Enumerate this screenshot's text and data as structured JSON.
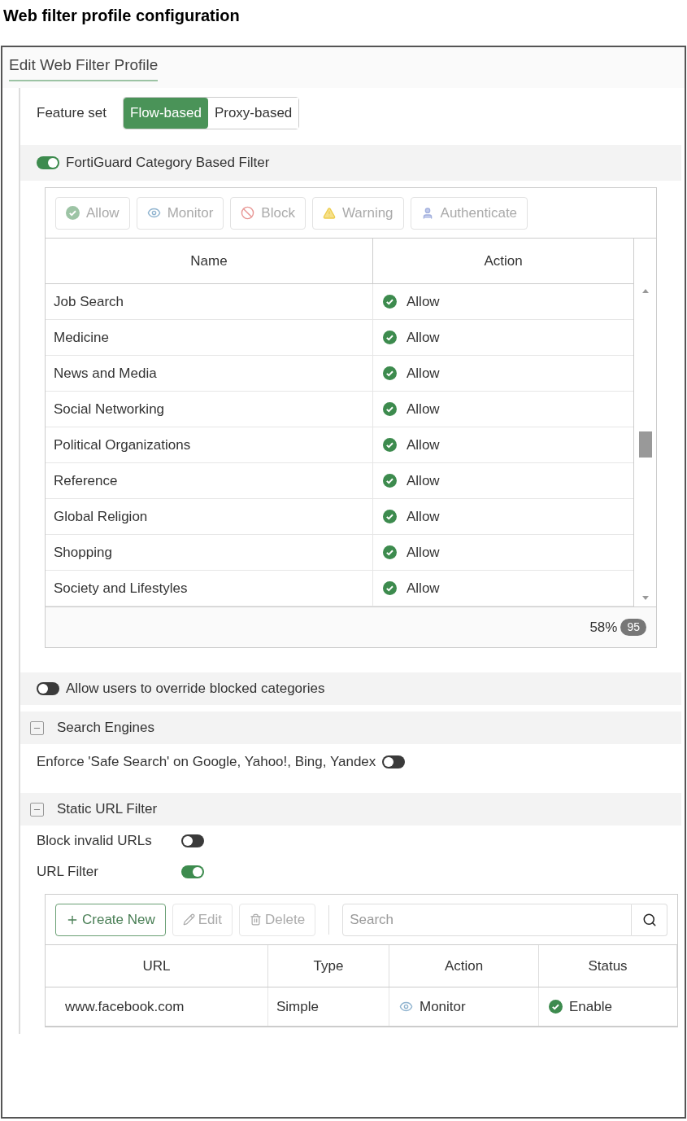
{
  "page_title": "Web filter profile configuration",
  "window": {
    "title": "Edit Web Filter Profile"
  },
  "feature_set": {
    "label": "Feature set",
    "options": [
      {
        "label": "Flow-based",
        "selected": true
      },
      {
        "label": "Proxy-based",
        "selected": false
      }
    ]
  },
  "fortiguard": {
    "label": "FortiGuard Category Based Filter",
    "on": true,
    "toolbar": [
      {
        "kind": "allow",
        "label": "Allow",
        "disabled": true
      },
      {
        "kind": "monitor",
        "label": "Monitor",
        "disabled": true
      },
      {
        "kind": "block",
        "label": "Block",
        "disabled": true
      },
      {
        "kind": "warning",
        "label": "Warning",
        "disabled": true
      },
      {
        "kind": "authenticate",
        "label": "Authenticate",
        "disabled": true
      }
    ],
    "columns": [
      "Name",
      "Action"
    ],
    "rows": [
      {
        "name": "Job Search",
        "action": "Allow",
        "kind": "allow"
      },
      {
        "name": "Medicine",
        "action": "Allow",
        "kind": "allow"
      },
      {
        "name": "News and Media",
        "action": "Allow",
        "kind": "allow"
      },
      {
        "name": "Social Networking",
        "action": "Allow",
        "kind": "allow"
      },
      {
        "name": "Political Organizations",
        "action": "Allow",
        "kind": "allow"
      },
      {
        "name": "Reference",
        "action": "Allow",
        "kind": "allow"
      },
      {
        "name": "Global Religion",
        "action": "Allow",
        "kind": "allow"
      },
      {
        "name": "Shopping",
        "action": "Allow",
        "kind": "allow"
      },
      {
        "name": "Society and Lifestyles",
        "action": "Allow",
        "kind": "allow"
      }
    ],
    "footer": {
      "percent": "58%",
      "count": "95"
    }
  },
  "override": {
    "label": "Allow users to override blocked categories",
    "on": false
  },
  "search_engines": {
    "title": "Search Engines",
    "expanded": true,
    "safe_search": {
      "label": "Enforce 'Safe Search' on Google, Yahoo!, Bing, Yandex",
      "on": false
    }
  },
  "static_url": {
    "title": "Static URL Filter",
    "expanded": true,
    "options": [
      {
        "label": "Block invalid URLs",
        "on": false
      },
      {
        "label": "URL Filter",
        "on": true
      }
    ],
    "toolbar": [
      {
        "kind": "create",
        "label": "Create New",
        "disabled": false
      },
      {
        "kind": "edit",
        "label": "Edit",
        "disabled": true
      },
      {
        "kind": "delete",
        "label": "Delete",
        "disabled": true
      }
    ],
    "search": {
      "placeholder": "Search"
    },
    "columns": [
      "URL",
      "Type",
      "Action",
      "Status"
    ],
    "rows": [
      {
        "url": "www.facebook.com",
        "type": "Simple",
        "action": {
          "label": "Monitor",
          "kind": "monitor"
        },
        "status": {
          "label": "Enable",
          "kind": "allow"
        }
      }
    ]
  }
}
